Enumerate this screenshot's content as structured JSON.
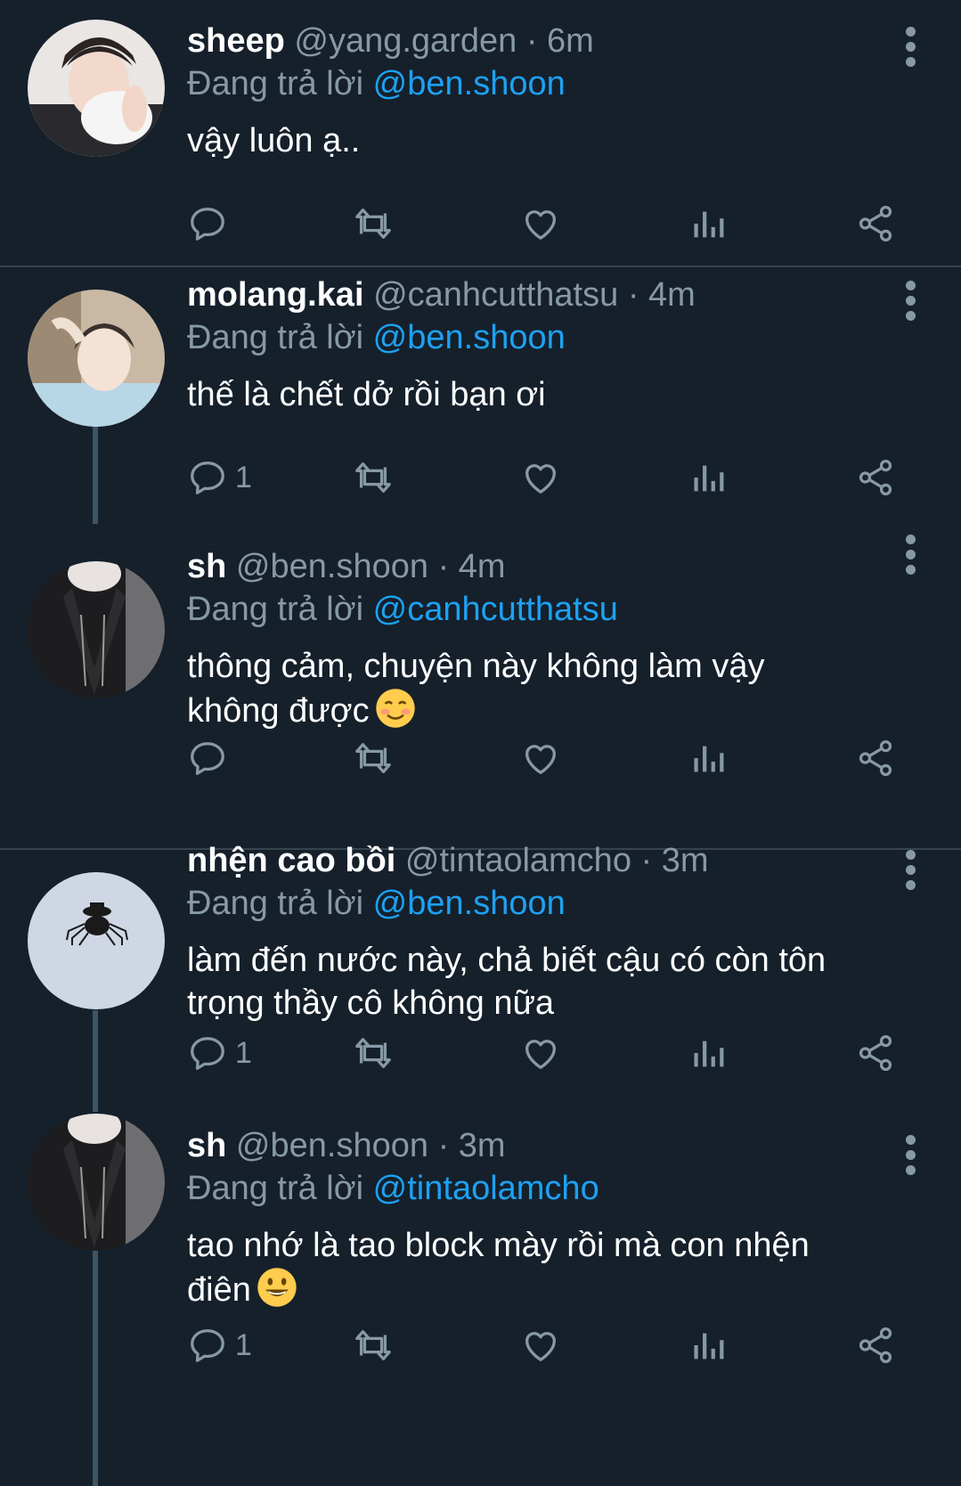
{
  "theme": {
    "background": "#15202b",
    "text_primary": "#ffffff",
    "text_secondary": "#8899a6",
    "accent": "#1da1f2",
    "divider": "#38444d"
  },
  "tweets": [
    {
      "name": "sheep",
      "handle": "@yang.garden",
      "time": "6m",
      "reply_prefix": "Đang trả lời",
      "reply_to": "@ben.shoon",
      "text": "vậy luôn ạ..",
      "reply_count": "",
      "avatar": "photo-boy-pillow"
    },
    {
      "name": "molang.kai",
      "handle": "@canhcutthatsu",
      "time": "4m",
      "reply_prefix": "Đang trả lời",
      "reply_to": "@ben.shoon",
      "text": "thế là chết dở rồi bạn ơi",
      "reply_count": "1",
      "avatar": "photo-boy-light"
    },
    {
      "name": "sh",
      "handle": "@ben.shoon",
      "time": "4m",
      "reply_prefix": "Đang trả lời",
      "reply_to": "@canhcutthatsu",
      "text_line1": "thông cảm, chuyện này không làm vậy",
      "text_line2": "không được",
      "emoji": "smiling-blush-emoji",
      "reply_count": "",
      "avatar": "photo-dark-jacket"
    },
    {
      "name": "nhện cao bồi",
      "handle": "@tintaolamcho",
      "time": "3m",
      "reply_prefix": "Đang trả lời",
      "reply_to": "@ben.shoon",
      "text_line1": "làm đến nước này, chả biết cậu có còn tôn",
      "text_line2": "trọng thầy cô không nữa",
      "reply_count": "1",
      "avatar": "drawing-spider-cowboy"
    },
    {
      "name": "sh",
      "handle": "@ben.shoon",
      "time": "3m",
      "reply_prefix": "Đang trả lời",
      "reply_to": "@tintaolamcho",
      "text_line1": "tao nhớ là tao block mày rồi mà con nhện",
      "text_line2": "điên",
      "emoji": "grinning-emoji",
      "reply_count": "1",
      "avatar": "photo-dark-jacket"
    }
  ],
  "separator": "·",
  "action_icons": [
    "reply-icon",
    "retweet-icon",
    "like-icon",
    "analytics-icon",
    "share-icon"
  ]
}
